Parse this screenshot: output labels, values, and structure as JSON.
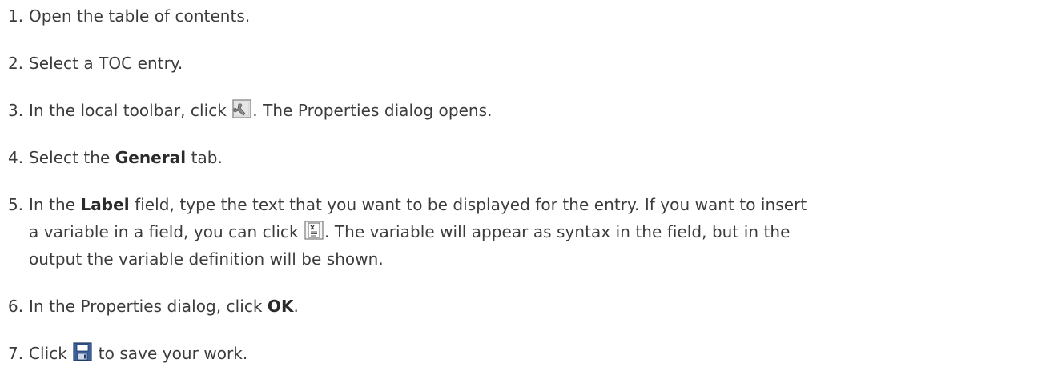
{
  "steps": [
    {
      "num": "1.",
      "text": "Open the table of contents."
    },
    {
      "num": "2.",
      "text": "Select a TOC entry."
    },
    {
      "num": "3.",
      "pre": "In the local toolbar, click ",
      "icon": "properties-icon",
      "post": ". The Properties dialog opens."
    },
    {
      "num": "4.",
      "pre": "Select the ",
      "bold": "General",
      "post": " tab."
    },
    {
      "num": "5.",
      "pre": "In the ",
      "bold": "Label",
      "mid": " field, type the text that you want to be displayed for the entry. If you want to insert",
      "line2_pre": "a variable in a field, you can click ",
      "icon": "insert-variable-icon",
      "line2_post": ". The variable will appear as syntax in the field, but in the",
      "line3": "output the variable definition will be shown."
    },
    {
      "num": "6.",
      "pre": "In the Properties dialog, click ",
      "bold": "OK",
      "post": "."
    },
    {
      "num": "7.",
      "pre": "Click ",
      "icon": "save-icon",
      "post": " to save your work."
    }
  ]
}
